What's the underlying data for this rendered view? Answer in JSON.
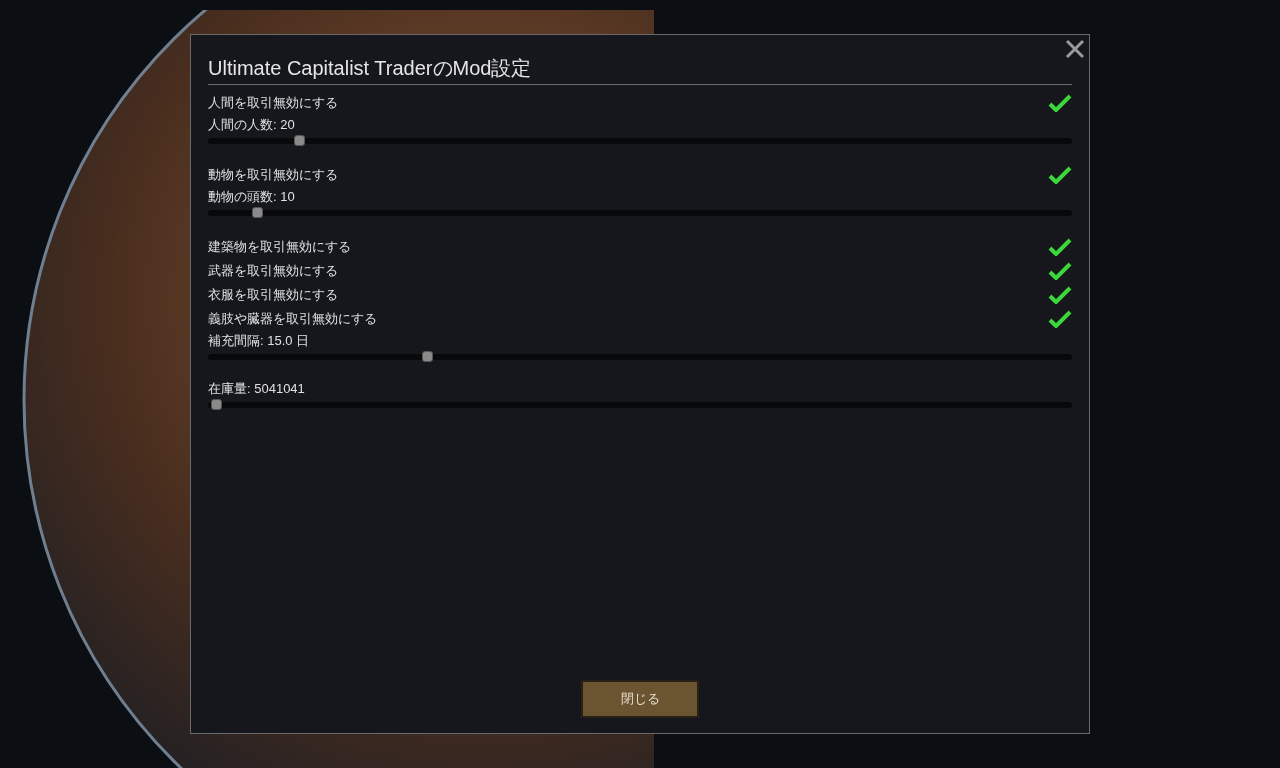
{
  "dialog": {
    "title": "Ultimate Capitalist TraderのMod設定",
    "settings": [
      {
        "kind": "checkbox",
        "label": "人間を取引無効にする",
        "checked": true
      },
      {
        "kind": "slider",
        "label": "人間の人数: 20",
        "level": 0.105
      },
      {
        "kind": "checkbox",
        "label": "動物を取引無効にする",
        "checked": true
      },
      {
        "kind": "slider",
        "label": "動物の頭数: 10",
        "level": 0.057
      },
      {
        "kind": "checkbox",
        "label": "建築物を取引無効にする",
        "checked": true
      },
      {
        "kind": "checkbox",
        "label": "武器を取引無効にする",
        "checked": true
      },
      {
        "kind": "checkbox",
        "label": "衣服を取引無効にする",
        "checked": true
      },
      {
        "kind": "checkbox",
        "label": "義肢や臓器を取引無効にする",
        "checked": true
      },
      {
        "kind": "slider",
        "label": "補充間隔: 15.0 日",
        "level": 0.253
      },
      {
        "kind": "slider",
        "label": "在庫量: 5041041",
        "level": 0.009
      }
    ],
    "close_button": "閉じる"
  }
}
